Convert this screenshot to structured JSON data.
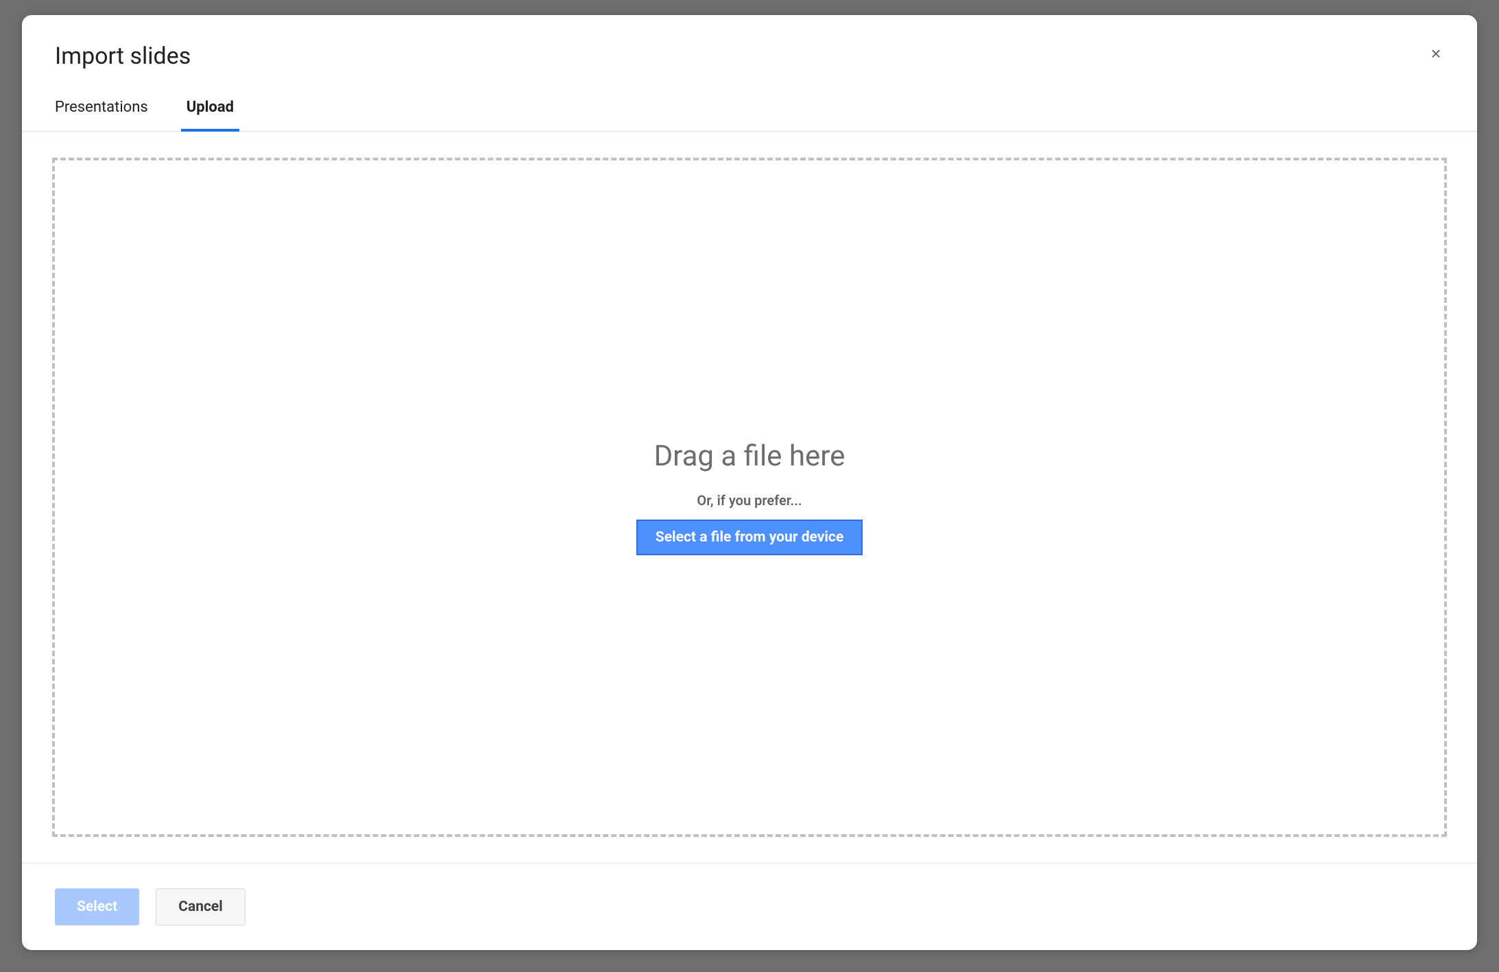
{
  "modal": {
    "title": "Import slides",
    "close_icon": "×",
    "tabs": [
      {
        "label": "Presentations",
        "active": false
      },
      {
        "label": "Upload",
        "active": true
      }
    ],
    "dropzone": {
      "drag_text": "Drag a file here",
      "prefer_text": "Or, if you prefer...",
      "select_file_button": "Select a file from your device"
    },
    "footer": {
      "select_label": "Select",
      "cancel_label": "Cancel"
    }
  }
}
